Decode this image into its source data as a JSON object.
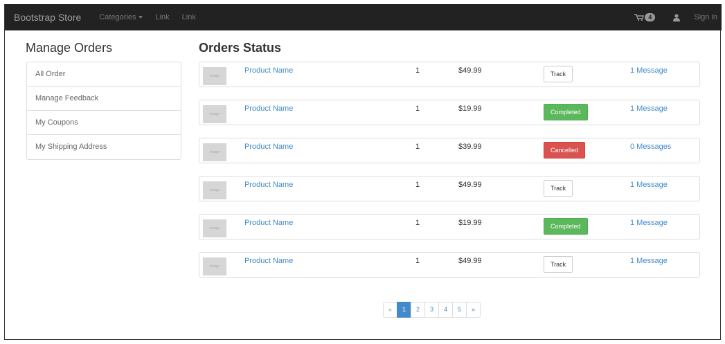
{
  "navbar": {
    "brand": "Bootstrap Store",
    "categories_label": "Categories",
    "links": [
      "Link",
      "Link"
    ],
    "cart_count": "4",
    "signin_label": "Sign in"
  },
  "sidebar": {
    "title": "Manage Orders",
    "items": [
      {
        "label": "All Order"
      },
      {
        "label": "Manage Feedback"
      },
      {
        "label": "My Coupons"
      },
      {
        "label": "My Shipping Address"
      }
    ]
  },
  "main": {
    "title": "Orders Status",
    "orders": [
      {
        "thumb": "Image",
        "product": "Product Name",
        "qty": "1",
        "price": "$49.99",
        "status": "Track",
        "status_type": "default",
        "messages": "1 Message"
      },
      {
        "thumb": "Image",
        "product": "Product Name",
        "qty": "1",
        "price": "$19.99",
        "status": "Completed",
        "status_type": "completed",
        "messages": "1 Message"
      },
      {
        "thumb": "Image",
        "product": "Product Name",
        "qty": "1",
        "price": "$39.99",
        "status": "Cancelled",
        "status_type": "cancelled",
        "messages": "0 Messages"
      },
      {
        "thumb": "Image",
        "product": "Product Name",
        "qty": "1",
        "price": "$49.99",
        "status": "Track",
        "status_type": "default",
        "messages": "1 Message"
      },
      {
        "thumb": "Image",
        "product": "Product Name",
        "qty": "1",
        "price": "$19.99",
        "status": "Completed",
        "status_type": "completed",
        "messages": "1 Message"
      },
      {
        "thumb": "Image",
        "product": "Product Name",
        "qty": "1",
        "price": "$49.99",
        "status": "Track",
        "status_type": "default",
        "messages": "1 Message"
      }
    ]
  },
  "pagination": {
    "prev": "«",
    "pages": [
      "1",
      "2",
      "3",
      "4",
      "5"
    ],
    "active_page": "1",
    "next": "»"
  },
  "colors": {
    "navbar_bg": "#222222",
    "link": "#428bca",
    "completed": "#5cb85c",
    "cancelled": "#d9534f",
    "active_page": "#428bca"
  },
  "icons": {
    "cart": "shopping-cart-icon",
    "user": "user-icon",
    "dropdown": "caret-down-icon"
  }
}
